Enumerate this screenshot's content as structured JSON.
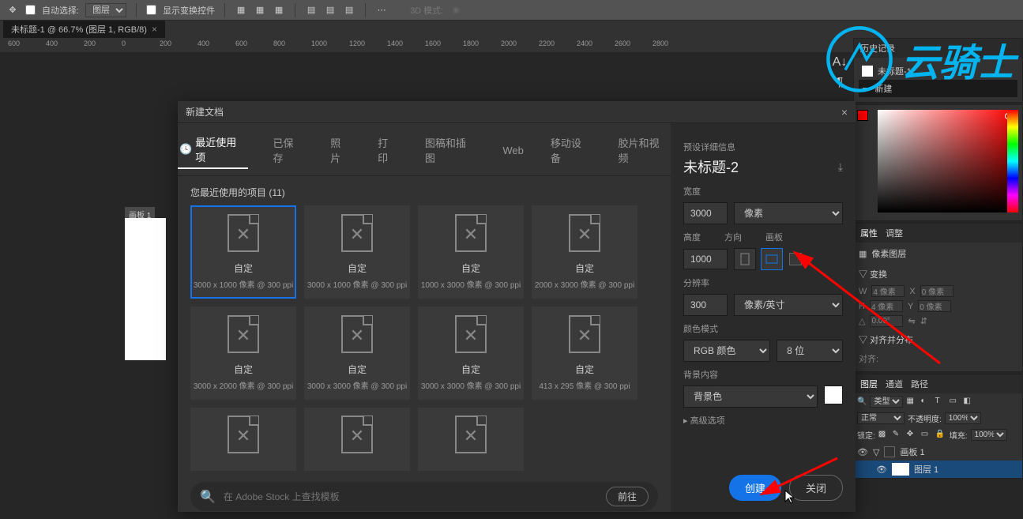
{
  "toolbar": {
    "auto_select_label": "自动选择:",
    "auto_select_value": "图层",
    "show_transform_label": "显示变换控件",
    "threed_label": "3D 模式:"
  },
  "doc_tab": {
    "title": "未标题-1 @ 66.7% (图层 1, RGB/8)"
  },
  "ruler": {
    "marks": [
      "600",
      "400",
      "200",
      "0",
      "200",
      "400",
      "600",
      "800",
      "1000",
      "1200",
      "1400",
      "1600",
      "1800",
      "2000",
      "2200",
      "2400",
      "2600",
      "2800"
    ]
  },
  "artboard": {
    "label": "画板 1"
  },
  "panels": {
    "history": {
      "title": "历史记录",
      "items": [
        "未标题-1",
        "新建"
      ]
    },
    "properties_tab": "属性",
    "adjust_tab": "调整",
    "pixel_layer": "像素图层",
    "transform": {
      "title": "变换",
      "w_label": "W",
      "h_label": "H",
      "x_label": "X",
      "y_label": "Y",
      "w": "4 像素",
      "h": "4 像素",
      "x": "0 像素",
      "y": "0 像素",
      "angle": "0.00°"
    },
    "align": {
      "title": "对齐并分布",
      "align_label": "对齐:"
    },
    "layer_tabs": {
      "layers": "图层",
      "channels": "通道",
      "paths": "路径"
    },
    "layer_panel": {
      "kind": "类型",
      "blend": "正常",
      "opacity_label": "不透明度:",
      "opacity": "100%",
      "lock_label": "锁定:",
      "fill_label": "填充:",
      "fill": "100%",
      "artboard": "画板 1",
      "layer1": "图层 1"
    }
  },
  "modal": {
    "title": "新建文档",
    "tabs": [
      "最近使用项",
      "已保存",
      "照片",
      "打印",
      "图稿和插图",
      "Web",
      "移动设备",
      "胶片和视频"
    ],
    "section": "您最近使用的项目 (11)",
    "presets": [
      {
        "name": "自定",
        "dims": "3000 x 1000 像素 @ 300 ppi",
        "selected": true
      },
      {
        "name": "自定",
        "dims": "3000 x 1000 像素 @ 300 ppi"
      },
      {
        "name": "自定",
        "dims": "1000 x 3000 像素 @ 300 ppi"
      },
      {
        "name": "自定",
        "dims": "2000 x 3000 像素 @ 300 ppi"
      },
      {
        "name": "自定",
        "dims": "3000 x 2000 像素 @ 300 ppi"
      },
      {
        "name": "自定",
        "dims": "3000 x 3000 像素 @ 300 ppi"
      },
      {
        "name": "自定",
        "dims": "3000 x 3000 像素 @ 300 ppi"
      },
      {
        "name": "自定",
        "dims": "413 x 295 像素 @ 300 ppi"
      }
    ],
    "extra_presets": 3,
    "stock_placeholder": "在 Adobe Stock 上查找模板",
    "stock_go": "前往",
    "details": {
      "header": "预设详细信息",
      "name": "未标题-2",
      "width_label": "宽度",
      "width": "3000",
      "width_unit": "像素",
      "height_label": "高度",
      "orient_label": "方向",
      "artboard_label": "画板",
      "height": "1000",
      "res_label": "分辨率",
      "res": "300",
      "res_unit": "像素/英寸",
      "color_label": "颜色模式",
      "color_mode": "RGB 颜色",
      "color_depth": "8 位",
      "bg_label": "背景内容",
      "bg": "背景色",
      "advanced": "高级选项"
    },
    "create": "创建",
    "close": "关闭"
  },
  "watermark": "云骑士"
}
